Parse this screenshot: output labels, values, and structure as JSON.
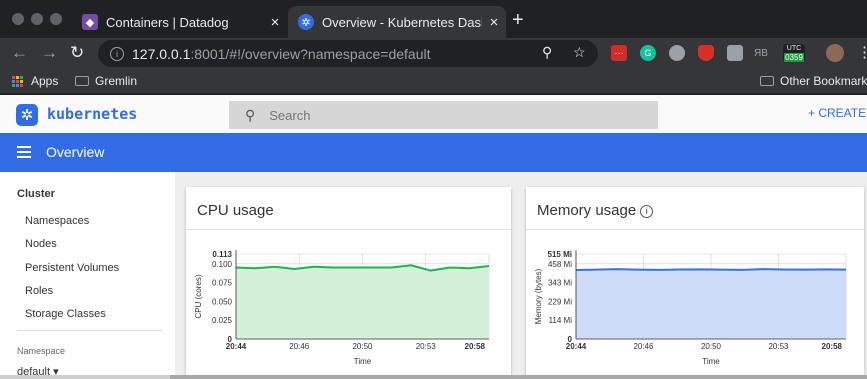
{
  "browser": {
    "tabs": [
      {
        "title": "Containers | Datadog",
        "icon": "datadog-dog-icon",
        "active": false
      },
      {
        "title": "Overview - Kubernetes Dashboard",
        "icon": "kubernetes-helm-icon",
        "active": true
      }
    ],
    "new_tab_label": "+",
    "close_label": "×",
    "address": {
      "host": "127.0.0.1",
      "rest": ":8001/#!/overview?namespace=default"
    },
    "extensions": [
      {
        "name": "lastpass-icon",
        "label": "···",
        "color": "#d32d27"
      },
      {
        "name": "grammarly-icon",
        "label": "G",
        "color": "#15c39a"
      },
      {
        "name": "circle-extension-icon",
        "label": "",
        "color": "#9aa0a6"
      },
      {
        "name": "shield-extension-icon",
        "label": "",
        "color": "#d93025"
      },
      {
        "name": "hexagon-extension-icon",
        "label": "",
        "color": "#9aa0a6"
      },
      {
        "name": "yb-extension-icon",
        "label": "ЯB",
        "color": "#35363a"
      }
    ],
    "clock": {
      "zone": "UTC",
      "time": "0359"
    },
    "bookmarks": {
      "apps": "Apps",
      "gremlin": "Gremlin",
      "other": "Other Bookmarks"
    }
  },
  "header": {
    "brand": "kubernetes",
    "search_placeholder": "Search",
    "create_label": "+ CREATE"
  },
  "bar": {
    "title": "Overview"
  },
  "sidebar": {
    "cluster_title": "Cluster",
    "items": [
      "Namespaces",
      "Nodes",
      "Persistent Volumes",
      "Roles",
      "Storage Classes"
    ],
    "namespace_title": "Namespace",
    "namespace_value": "default"
  },
  "colors": {
    "k8s_blue": "#326ce5",
    "cpu_line": "#1fb54e",
    "cpu_fill": "#d4f0d8",
    "mem_line": "#3a73d1",
    "mem_fill": "#cfdcf7"
  },
  "chart_data": [
    {
      "type": "area",
      "title": "CPU usage",
      "xlabel": "Time",
      "ylabel": "CPU (cores)",
      "x_ticks": [
        "20:44",
        "20:46",
        "20:50",
        "20:53",
        "20:58"
      ],
      "y_ticks": [
        "0",
        "0.025",
        "0.050",
        "0.075",
        "0.100",
        "0.113"
      ],
      "ylim": [
        0,
        0.113
      ],
      "grid": true,
      "x": [
        0,
        1,
        2,
        3,
        4,
        5,
        6,
        7,
        8,
        9,
        10,
        11,
        12,
        13
      ],
      "values": [
        0.095,
        0.094,
        0.096,
        0.093,
        0.096,
        0.095,
        0.095,
        0.095,
        0.095,
        0.098,
        0.091,
        0.095,
        0.094,
        0.097
      ]
    },
    {
      "type": "area",
      "title": "Memory usage",
      "xlabel": "Time",
      "ylabel": "Memory (bytes)",
      "x_ticks": [
        "20:44",
        "20:46",
        "20:50",
        "20:53",
        "20:58"
      ],
      "y_ticks": [
        "0",
        "114 Mi",
        "229 Mi",
        "343 Mi",
        "458 Mi",
        "515 Mi"
      ],
      "ylim": [
        0,
        515
      ],
      "grid": true,
      "x": [
        0,
        1,
        2,
        3,
        4,
        5,
        6,
        7,
        8,
        9,
        10,
        11,
        12,
        13
      ],
      "values": [
        418,
        420,
        423,
        420,
        419,
        421,
        422,
        420,
        419,
        423,
        421,
        420,
        422,
        420
      ]
    }
  ]
}
